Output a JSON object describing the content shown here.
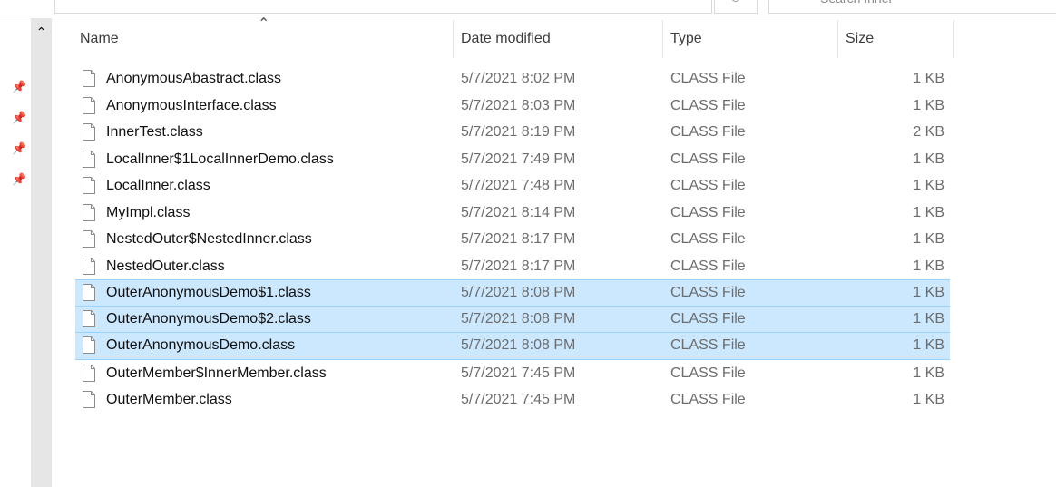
{
  "toolbar": {
    "search_placeholder": "Search Inner"
  },
  "columns": {
    "name": "Name",
    "date": "Date modified",
    "type": "Type",
    "size": "Size"
  },
  "files": [
    {
      "name": "AnonymousAbastract.class",
      "date": "5/7/2021 8:02 PM",
      "type": "CLASS File",
      "size": "1 KB",
      "selected": false
    },
    {
      "name": "AnonymousInterface.class",
      "date": "5/7/2021 8:03 PM",
      "type": "CLASS File",
      "size": "1 KB",
      "selected": false
    },
    {
      "name": "InnerTest.class",
      "date": "5/7/2021 8:19 PM",
      "type": "CLASS File",
      "size": "2 KB",
      "selected": false
    },
    {
      "name": "LocalInner$1LocalInnerDemo.class",
      "date": "5/7/2021 7:49 PM",
      "type": "CLASS File",
      "size": "1 KB",
      "selected": false
    },
    {
      "name": "LocalInner.class",
      "date": "5/7/2021 7:48 PM",
      "type": "CLASS File",
      "size": "1 KB",
      "selected": false
    },
    {
      "name": "MyImpl.class",
      "date": "5/7/2021 8:14 PM",
      "type": "CLASS File",
      "size": "1 KB",
      "selected": false
    },
    {
      "name": "NestedOuter$NestedInner.class",
      "date": "5/7/2021 8:17 PM",
      "type": "CLASS File",
      "size": "1 KB",
      "selected": false
    },
    {
      "name": "NestedOuter.class",
      "date": "5/7/2021 8:17 PM",
      "type": "CLASS File",
      "size": "1 KB",
      "selected": false
    },
    {
      "name": "OuterAnonymousDemo$1.class",
      "date": "5/7/2021 8:08 PM",
      "type": "CLASS File",
      "size": "1 KB",
      "selected": true
    },
    {
      "name": "OuterAnonymousDemo$2.class",
      "date": "5/7/2021 8:08 PM",
      "type": "CLASS File",
      "size": "1 KB",
      "selected": true
    },
    {
      "name": "OuterAnonymousDemo.class",
      "date": "5/7/2021 8:08 PM",
      "type": "CLASS File",
      "size": "1 KB",
      "selected": true
    },
    {
      "name": "OuterMember$InnerMember.class",
      "date": "5/7/2021 7:45 PM",
      "type": "CLASS File",
      "size": "1 KB",
      "selected": false
    },
    {
      "name": "OuterMember.class",
      "date": "5/7/2021 7:45 PM",
      "type": "CLASS File",
      "size": "1 KB",
      "selected": false
    }
  ],
  "colors": {
    "selection_bg": "#cce8ff",
    "selection_border": "#99d1ff",
    "scrollbar": "#e6e6e6"
  }
}
